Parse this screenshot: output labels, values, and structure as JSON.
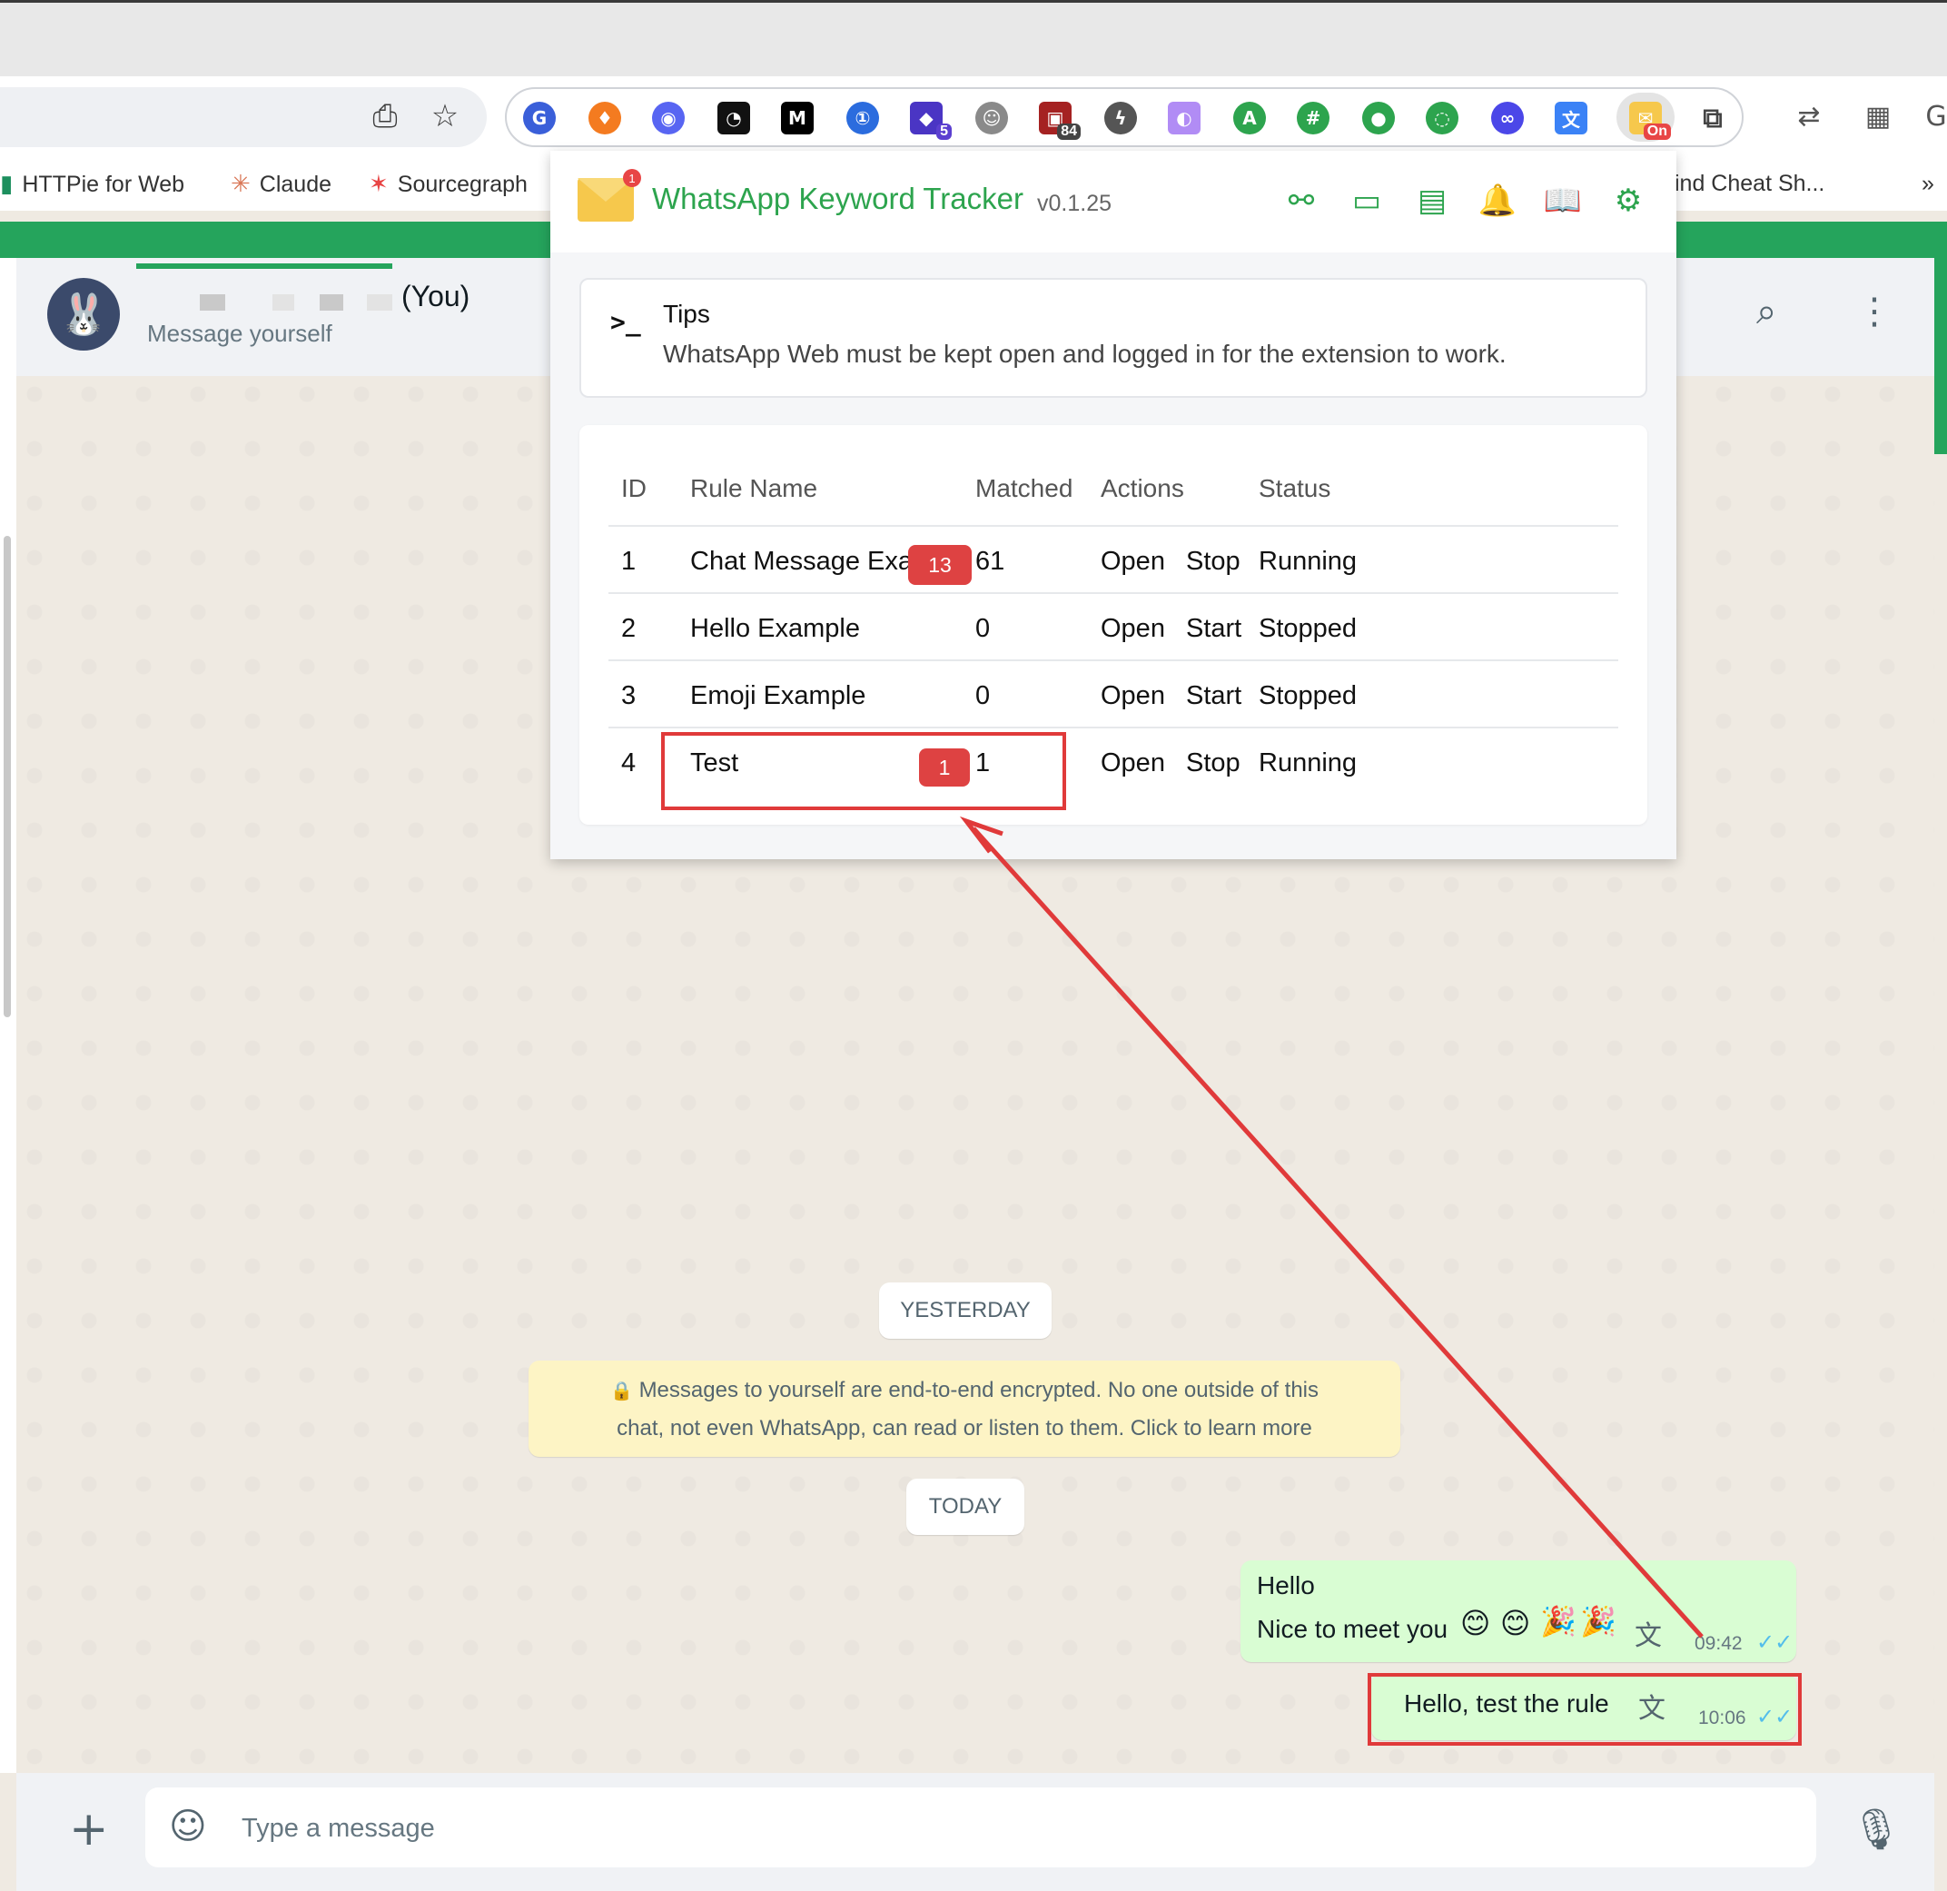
{
  "browser": {
    "bookmarks": [
      {
        "label": "HTTPie for Web",
        "icon": "httpie-icon"
      },
      {
        "label": "Claude",
        "icon": "claude-icon"
      },
      {
        "label": "Sourcegraph",
        "icon": "sourcegraph-icon"
      },
      {
        "label": "ind Cheat Sh...",
        "icon": "bookmark-icon"
      }
    ],
    "more_bookmarks": "»",
    "extension_badges": {
      "five": "5",
      "eightyfour": "84",
      "on": "On"
    }
  },
  "whatsapp": {
    "contact_name": "(You)",
    "contact_subtitle": "Message yourself",
    "chips": {
      "yesterday": "YESTERDAY",
      "today": "TODAY"
    },
    "encryption_notice": {
      "line1": "Messages to yourself are end-to-end encrypted. No one outside of this",
      "line2": "chat, not even WhatsApp, can read or listen to them. Click to learn more"
    },
    "messages": [
      {
        "line1": "Hello",
        "line2": "Nice to meet you",
        "time": "09:42"
      },
      {
        "text": "Hello, test the rule",
        "time": "10:06"
      }
    ],
    "composer": {
      "placeholder": "Type a message"
    }
  },
  "popup": {
    "logo_badge": "1",
    "title": "WhatsApp Keyword Tracker",
    "version": "v0.1.25",
    "tips": {
      "prompt": ">_",
      "title": "Tips",
      "text": "WhatsApp Web must be kept open and logged in for the extension to work."
    },
    "table": {
      "headers": [
        "ID",
        "Rule Name",
        "Matched",
        "Actions",
        "Status"
      ],
      "rows": [
        {
          "id": "1",
          "name": "Chat Message Example",
          "badge": "13",
          "matched": "61",
          "open": "Open",
          "toggle": "Stop",
          "status": "Running"
        },
        {
          "id": "2",
          "name": "Hello Example",
          "badge": "",
          "matched": "0",
          "open": "Open",
          "toggle": "Start",
          "status": "Stopped"
        },
        {
          "id": "3",
          "name": "Emoji Example",
          "badge": "",
          "matched": "0",
          "open": "Open",
          "toggle": "Start",
          "status": "Stopped"
        },
        {
          "id": "4",
          "name": "Test",
          "badge": "1",
          "matched": "1",
          "open": "Open",
          "toggle": "Stop",
          "status": "Running"
        }
      ]
    }
  },
  "colors": {
    "whatsapp_green": "#25a45c",
    "popup_accent": "#2da44e",
    "badge_red": "#de4242",
    "annotation_red": "#e03a3a",
    "bubble_green": "#d9fdd3"
  }
}
